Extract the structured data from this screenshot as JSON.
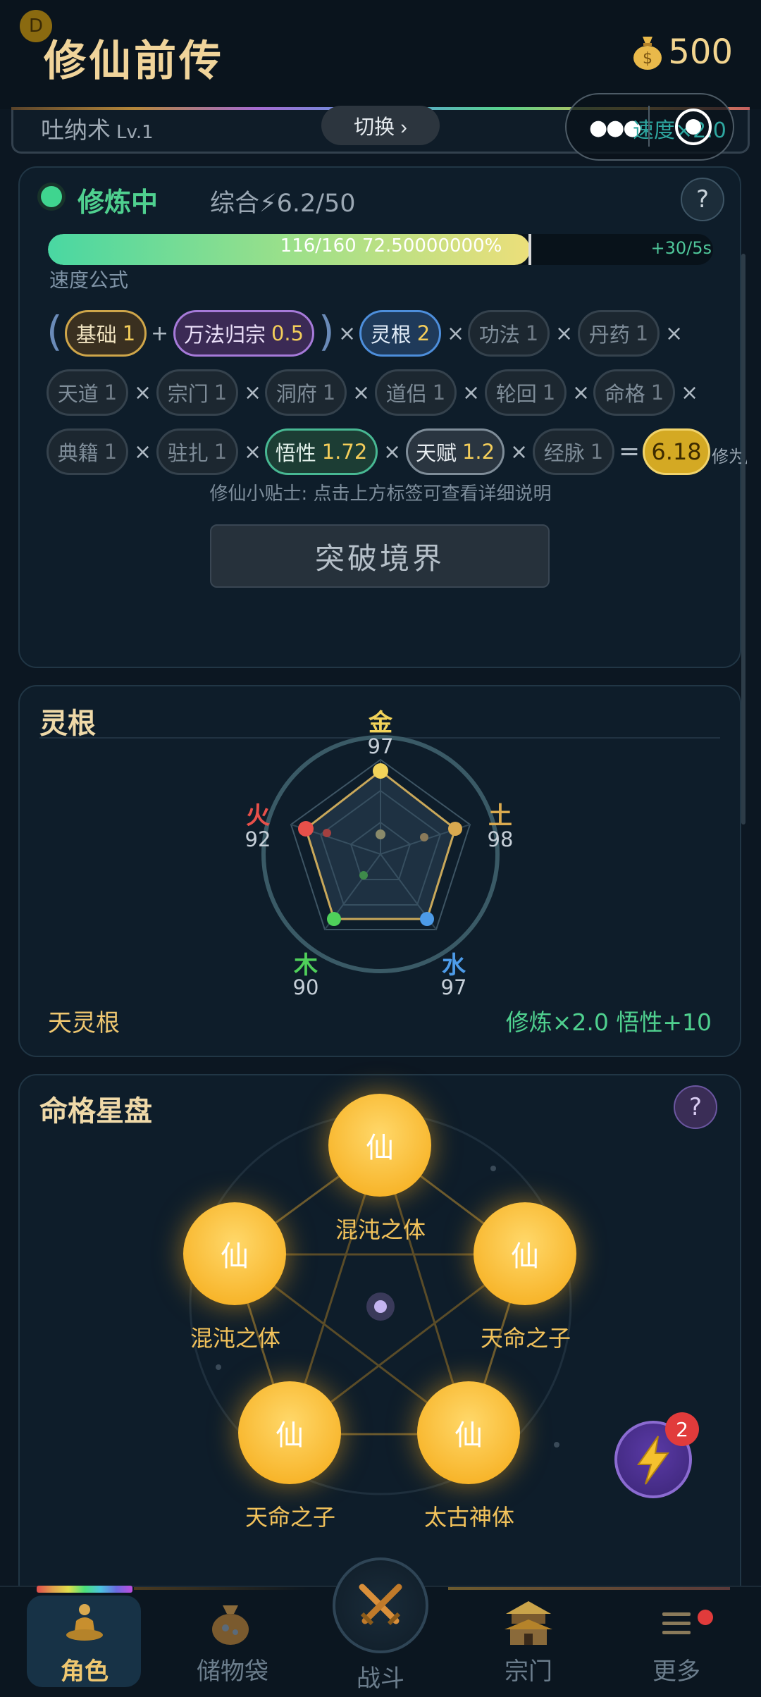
{
  "header": {
    "badge": "D",
    "title": "修仙前传",
    "coins": "500"
  },
  "technique": {
    "name": "吐纳术",
    "level": "Lv.1",
    "switch_label": "切换 ›",
    "speed_label": "速度",
    "speed_value": "×2.0"
  },
  "cultivation": {
    "status": "修炼中",
    "overall": "综合⚡6.2/50",
    "help": "?",
    "progress_text": "116/160  72.50000000%",
    "progress_fraction": 0.725,
    "rate": "+30/5s",
    "formula_label": "速度公式",
    "chips": {
      "base": {
        "name": "基础",
        "val": "1"
      },
      "wanfa": {
        "name": "万法归宗",
        "val": "0.5"
      },
      "linggen": {
        "name": "灵根",
        "val": "2"
      },
      "gongfa": {
        "name": "功法",
        "val": "1"
      },
      "danyao": {
        "name": "丹药",
        "val": "1"
      },
      "tiandao": {
        "name": "天道",
        "val": "1"
      },
      "zongmen": {
        "name": "宗门",
        "val": "1"
      },
      "dongfu": {
        "name": "洞府",
        "val": "1"
      },
      "daolv": {
        "name": "道侣",
        "val": "1"
      },
      "lunhui": {
        "name": "轮回",
        "val": "1"
      },
      "mingge": {
        "name": "命格",
        "val": "1"
      },
      "dianji": {
        "name": "典籍",
        "val": "1"
      },
      "zhuzha": {
        "name": "驻扎",
        "val": "1"
      },
      "wuxing": {
        "name": "悟性",
        "val": "1.72"
      },
      "tianfu": {
        "name": "天赋",
        "val": "1.2"
      },
      "jingmai": {
        "name": "经脉",
        "val": "1"
      }
    },
    "result": "6.18",
    "result_suffix": "修为/",
    "ops": {
      "plus": "+",
      "times": "×",
      "equals": "=",
      "lparen": "(",
      "rparen": ")"
    },
    "tip": "修仙小贴士: 点击上方标签可查看详细说明",
    "breakthrough": "突破境界"
  },
  "spirit_root": {
    "title": "灵根",
    "elements": {
      "metal": {
        "name": "金",
        "value": "97",
        "color": "#f2d35a"
      },
      "earth": {
        "name": "土",
        "value": "98",
        "color": "#d9a94f"
      },
      "water": {
        "name": "水",
        "value": "97",
        "color": "#4d9be8"
      },
      "wood": {
        "name": "木",
        "value": "90",
        "color": "#4fd05a"
      },
      "fire": {
        "name": "火",
        "value": "92",
        "color": "#e8504a"
      }
    },
    "type": "天灵根",
    "effect": "修炼×2.0  悟性+10"
  },
  "destiny": {
    "title": "命格星盘",
    "help": "?",
    "star_glyph": "仙",
    "stars": [
      "混沌之体",
      "混沌之体",
      "天命之子",
      "天命之子",
      "太古神体"
    ],
    "fab_badge": "2"
  },
  "nav": {
    "character": "角色",
    "bag": "储物袋",
    "battle": "战斗",
    "sect": "宗门",
    "more": "更多"
  }
}
